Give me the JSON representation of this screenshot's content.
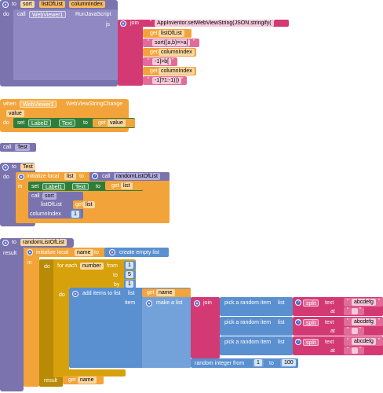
{
  "proc_sort": {
    "to": "to",
    "name": "sort",
    "params": [
      "listOfList",
      "columnIndex"
    ],
    "do": "do",
    "call": "call",
    "component": "WebViewer1",
    "method": "RunJavaScript",
    "js_label": "js",
    "join": "join",
    "str1": "AppInventor.setWebViewString(JSON.stringify(",
    "get1": "get",
    "var1": "listOfList",
    "str2": "sort((a,b)=>a[",
    "get2": "get",
    "var2": "columnIndex",
    "str3": "-1]>b[",
    "get3": "get",
    "var3": "columnIndex",
    "str4": "-1]?1:-1)))"
  },
  "event_when": {
    "when": "when",
    "component": "WebViewer1",
    "event": "WebViewStringChange",
    "param": "value",
    "do": "do",
    "set": "set",
    "target": "Label2",
    "prop": "Text",
    "to": "to",
    "get": "get",
    "var": "value"
  },
  "call_test": {
    "call": "call",
    "name": "Test"
  },
  "proc_test": {
    "to": "to",
    "name": "Test",
    "do": "do",
    "init": "initialize local",
    "local": "list",
    "to2": "to",
    "call": "call",
    "callee": "randomListOfList",
    "in": "in",
    "set": "set",
    "target": "Label1",
    "prop": "Text",
    "to3": "to",
    "get": "get",
    "var": "list",
    "call2": "call",
    "callee2": "sort",
    "arg1_label": "listOfList",
    "get2": "get",
    "var2": "list",
    "arg2_label": "columnIndex",
    "arg2_value": "1"
  },
  "proc_random": {
    "to": "to",
    "name": "randomListOfList",
    "result": "result",
    "init": "initialize local",
    "local": "name",
    "to2": "to",
    "create": "create empty list",
    "in": "in",
    "do": "do",
    "foreach": "for each",
    "var": "number",
    "from": "from",
    "from_val": "1",
    "to3": "to",
    "to_val": "5",
    "by": "by",
    "by_val": "1",
    "do2": "do",
    "add": "add items to list",
    "list": "list",
    "get": "get",
    "getvar": "name",
    "item": "item",
    "make": "make a list",
    "join": "join",
    "rows": [
      {
        "pick": "pick a random item",
        "list": "list",
        "split": "split",
        "text": "text",
        "str": "abcdefg",
        "at": "at",
        "at_str": ""
      },
      {
        "pick": "pick a random item",
        "list": "list",
        "split": "split",
        "text": "text",
        "str": "abcdefg",
        "at": "at",
        "at_str": ""
      },
      {
        "pick": "pick a random item",
        "list": "list",
        "split": "split",
        "text": "text",
        "str": "abcdefg",
        "at": "at",
        "at_str": ""
      }
    ],
    "random": "random integer from",
    "rfrom": "1",
    "rto_label": "to",
    "rto": "100",
    "result2": "result",
    "get2": "get",
    "var2": "name"
  },
  "colors": {
    "procedure": "#7a73ad",
    "text": "#d33a74",
    "variable": "#f2a43a",
    "component": "#2f7d3a",
    "list": "#5a8fd0",
    "control": "#d6a10b"
  }
}
